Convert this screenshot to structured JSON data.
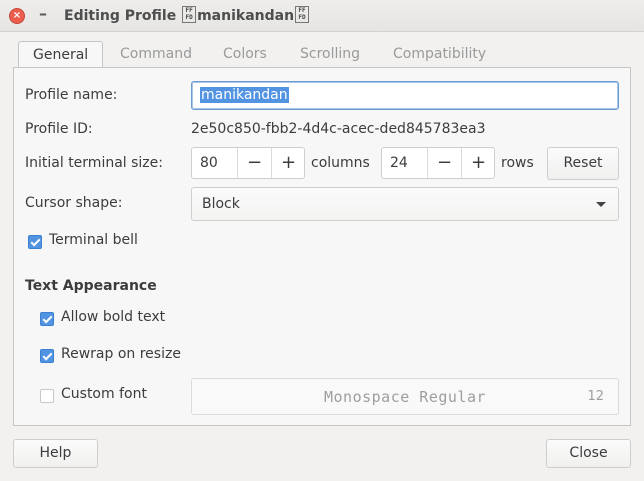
{
  "window": {
    "title_prefix": "Editing Profile",
    "title_name": "manikandan",
    "title_glyph_top": "FF",
    "title_glyph_bottom": "FD"
  },
  "tabs": [
    {
      "label": "General",
      "active": true
    },
    {
      "label": "Command",
      "active": false
    },
    {
      "label": "Colors",
      "active": false
    },
    {
      "label": "Scrolling",
      "active": false
    },
    {
      "label": "Compatibility",
      "active": false
    }
  ],
  "general": {
    "profile_name_label": "Profile name:",
    "profile_name_value": "manikandan",
    "profile_id_label": "Profile ID:",
    "profile_id_value": "2e50c850-fbb2-4d4c-acec-ded845783ea3",
    "terminal_size_label": "Initial terminal size:",
    "columns_value": "80",
    "columns_label": "columns",
    "rows_value": "24",
    "rows_label": "rows",
    "minus": "−",
    "plus": "+",
    "reset_label": "Reset",
    "cursor_shape_label": "Cursor shape:",
    "cursor_shape_value": "Block",
    "terminal_bell_label": "Terminal bell",
    "terminal_bell_checked": true,
    "text_appearance_heading": "Text Appearance",
    "allow_bold_label": "Allow bold text",
    "allow_bold_checked": true,
    "rewrap_label": "Rewrap on resize",
    "rewrap_checked": true,
    "custom_font_label": "Custom font",
    "custom_font_checked": false,
    "font_name": "Monospace Regular",
    "font_size": "12"
  },
  "footer": {
    "help_label": "Help",
    "close_label": "Close"
  },
  "colors": {
    "accent": "#5294e2",
    "close_button": "#ee5e4e"
  }
}
